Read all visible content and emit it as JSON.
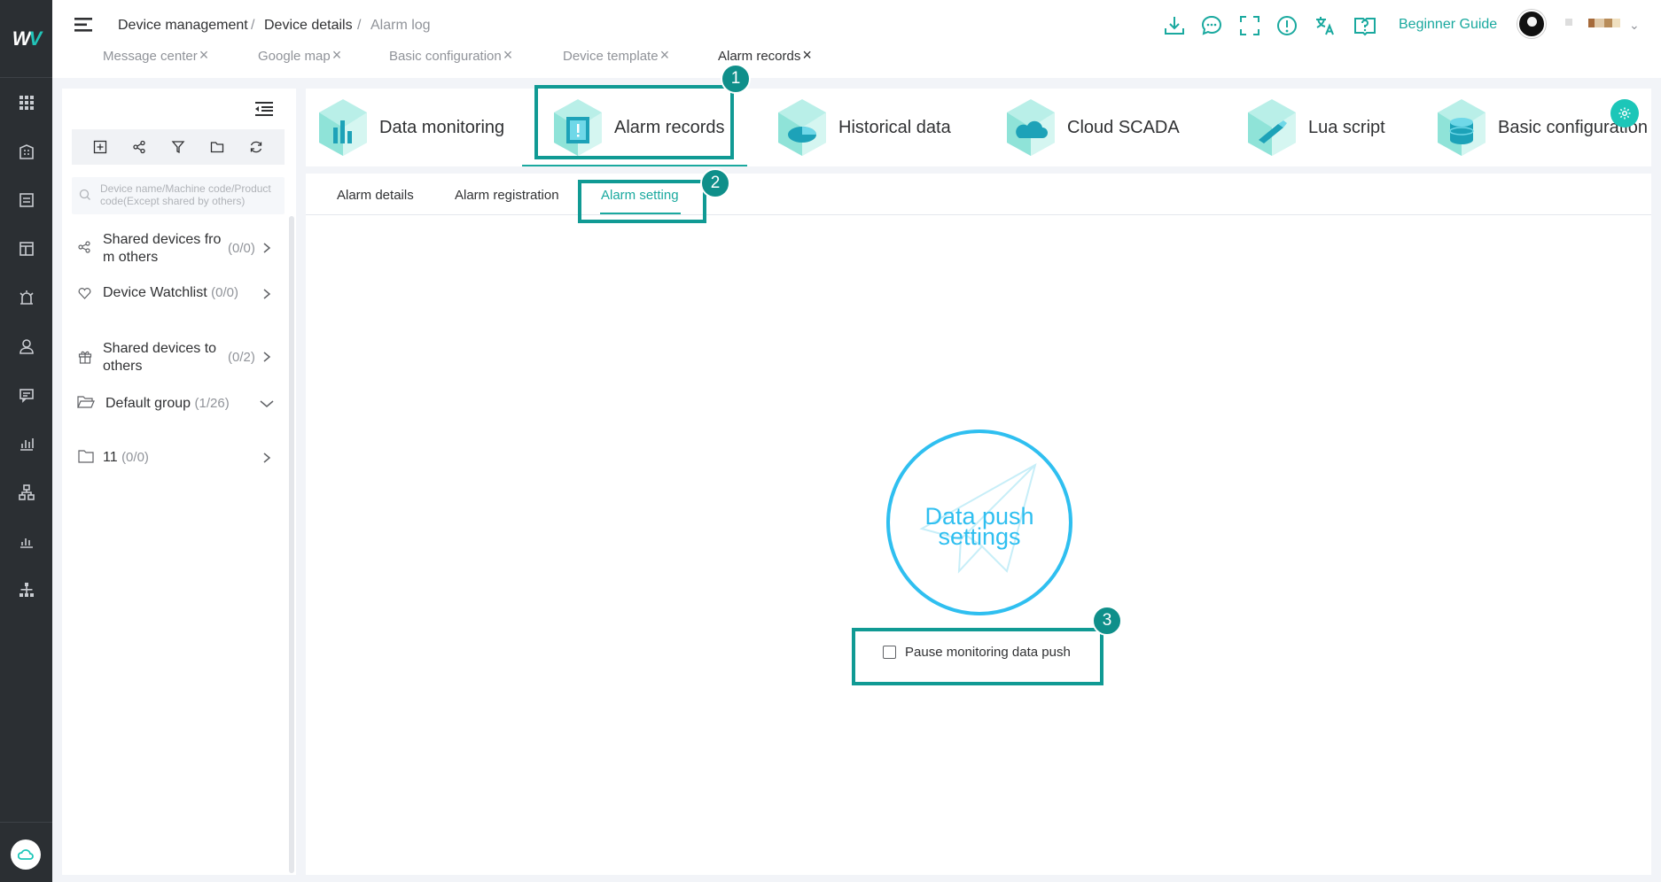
{
  "logo": {
    "text": "W",
    "accent": "#21c4b8"
  },
  "rail": {
    "icons": [
      "apps-icon",
      "building-icon",
      "list-card-icon",
      "layout-icon",
      "alarm-light-icon",
      "user-icon",
      "message-icon",
      "chart-icon",
      "org-icon",
      "bar-chart-icon",
      "sitemap-icon"
    ],
    "bottom_icon": "cloud-icon"
  },
  "header": {
    "breadcrumb": [
      "Device management",
      "Device details",
      "Alarm log"
    ],
    "tags": [
      "Message center",
      "Google map",
      "Basic configuration",
      "Device template",
      "Alarm records"
    ],
    "active_tag": "Alarm records",
    "icons": [
      "download-icon",
      "chat-icon",
      "fullscreen-icon",
      "info-icon",
      "translate-icon",
      "help-book-icon"
    ],
    "guide_label": "Beginner Guide"
  },
  "sidebar": {
    "search_placeholder": "Device name/Machine code/Product code(Except shared by others)",
    "toolbar_icons": [
      "add-icon",
      "share-icon",
      "filter-icon",
      "folder-icon",
      "refresh-icon"
    ],
    "items": [
      {
        "label_line1": "Shared devices fro",
        "label_line2": "m others",
        "count": "(0/0)"
      },
      {
        "label": "Device Watchlist",
        "count": "(0/0)"
      },
      {
        "label_line1": "Shared devices to",
        "label_line2": "others",
        "count": "(0/2)"
      },
      {
        "label": "Default group",
        "count": "(1/26)"
      },
      {
        "label": "11",
        "count": "(0/0)"
      }
    ]
  },
  "modules": [
    "Data monitoring",
    "Alarm records",
    "Historical data",
    "Cloud SCADA",
    "Lua script",
    "Basic configuration"
  ],
  "active_module": "Alarm records",
  "subtabs": [
    "Alarm details",
    "Alarm registration",
    "Alarm setting"
  ],
  "active_subtab": "Alarm setting",
  "push": {
    "line1": "Data push",
    "line2": "settings",
    "checkbox_label": "Pause monitoring data push",
    "checked": false
  },
  "annotations": [
    "1",
    "2",
    "3"
  ],
  "colors": {
    "accent": "#1aa99f",
    "highlight": "#109a94",
    "push_blue": "#2fbff0",
    "rail": "#2b2f33"
  }
}
